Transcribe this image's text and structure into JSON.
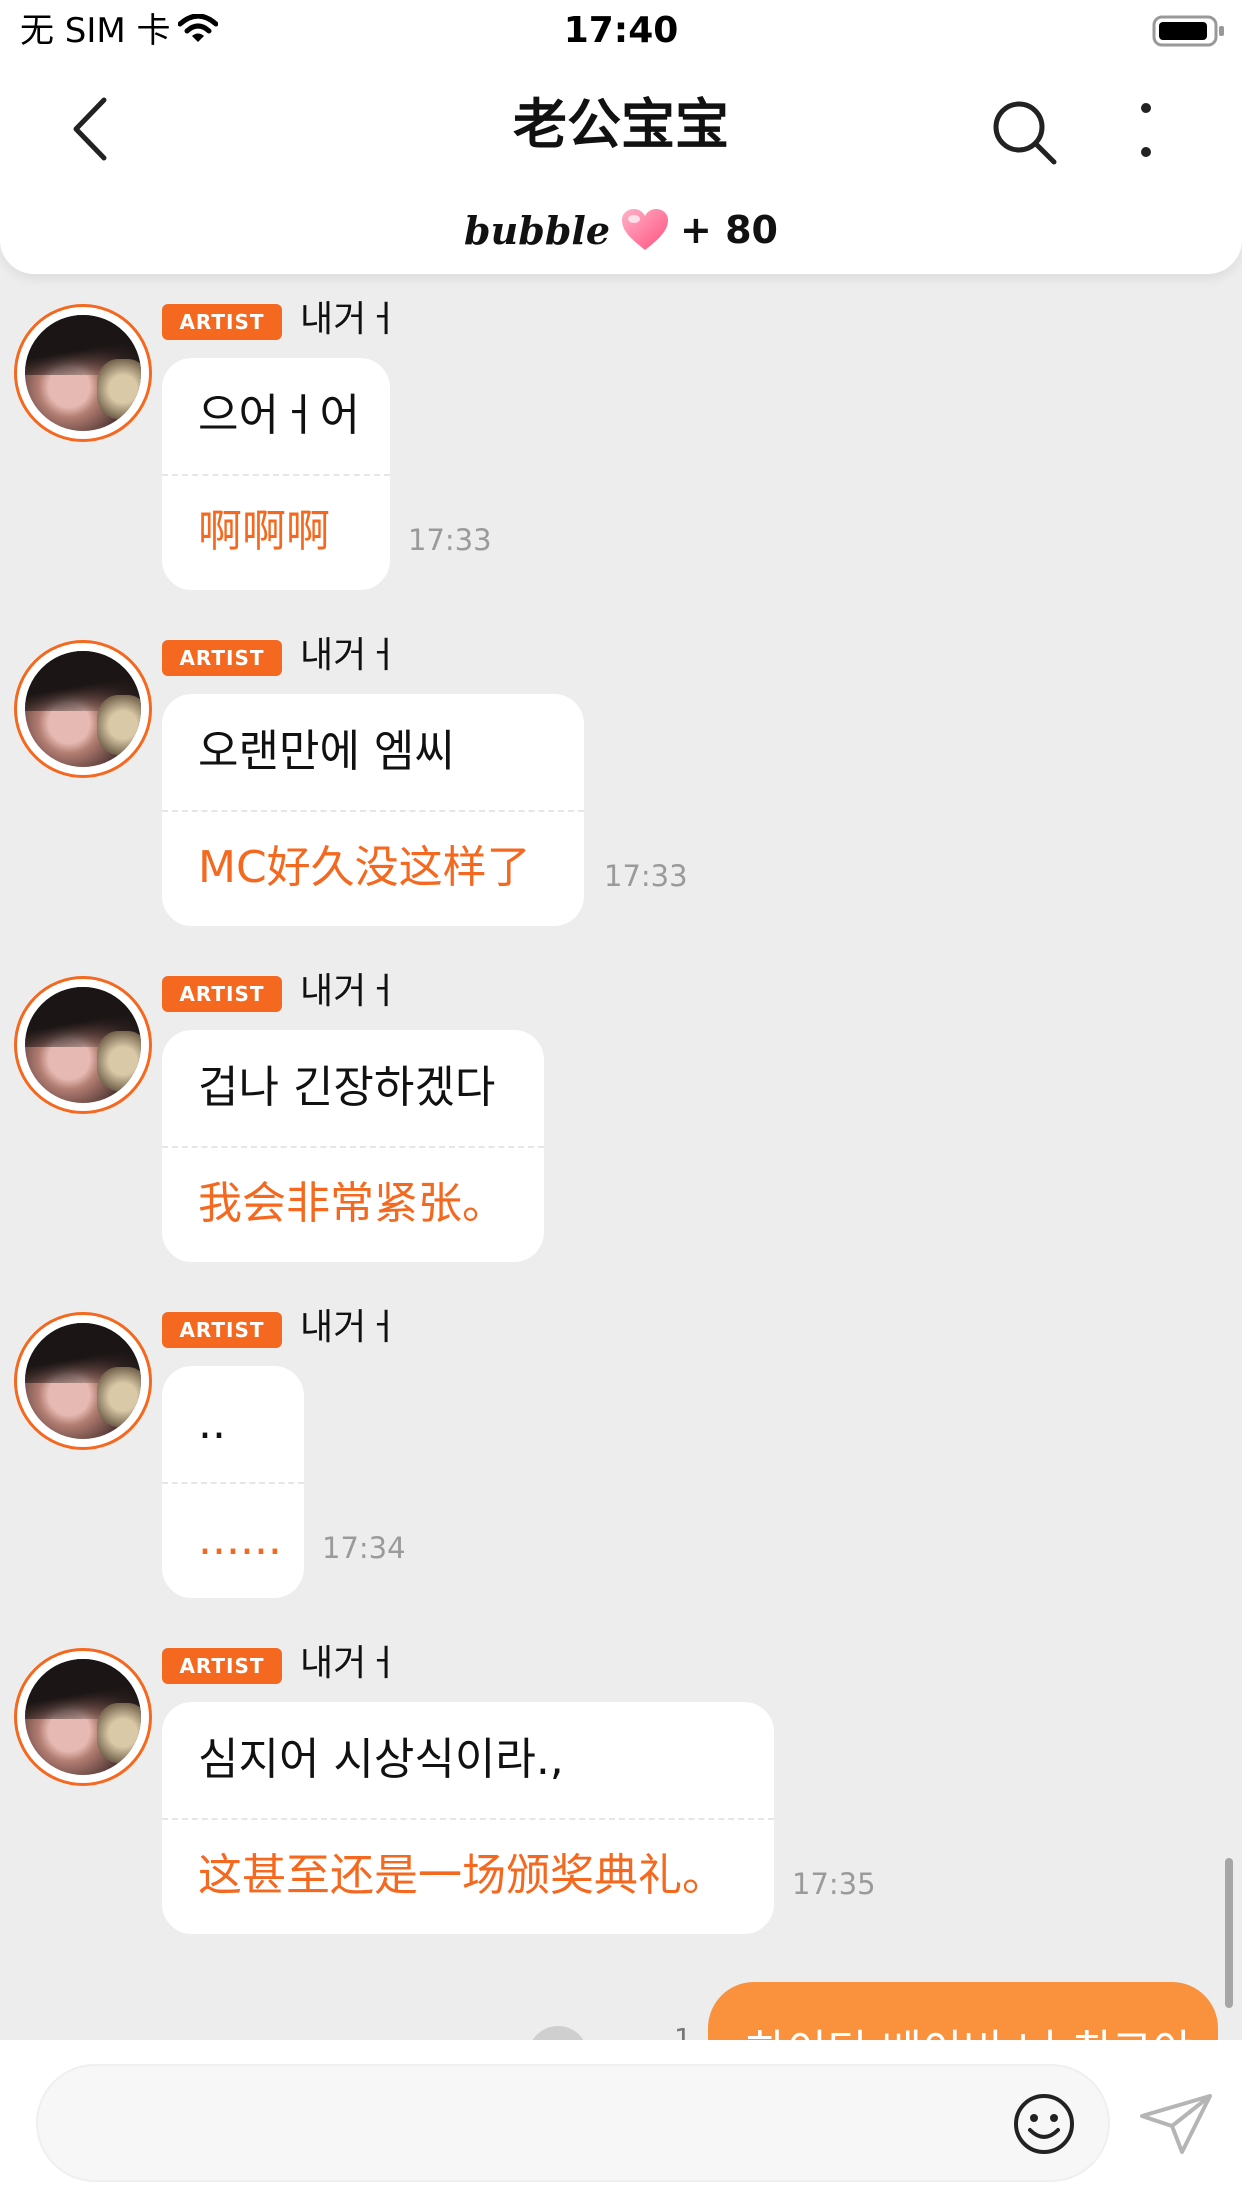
{
  "status_bar": {
    "carrier": "无 SIM 卡",
    "time": "17:40"
  },
  "header": {
    "title": "老公宝宝",
    "bubble_logo": "bubble",
    "bubble_count": "+ 80"
  },
  "messages": [
    {
      "badge": "ARTIST",
      "sender": "내거ㅓ",
      "original": "으어ㅓ어",
      "translation": "啊啊啊",
      "time": "17:33"
    },
    {
      "badge": "ARTIST",
      "sender": "내거ㅓ",
      "original": "오랜만에 엠씨",
      "translation": "MC好久没这样了",
      "time": "17:33"
    },
    {
      "badge": "ARTIST",
      "sender": "내거ㅓ",
      "original": "겁나 긴장하겠다",
      "translation": "我会非常紧张。",
      "time": ""
    },
    {
      "badge": "ARTIST",
      "sender": "내거ㅓ",
      "original": "..",
      "translation": "......",
      "time": "17:34"
    },
    {
      "badge": "ARTIST",
      "sender": "내거ㅓ",
      "original": "심지어 시상식이라.,",
      "translation": "这甚至还是一场颁奖典礼。",
      "time": "17:35"
    }
  ],
  "outgoing": {
    "read_count": "1",
    "text": "하이틴 베이비 너 최고야"
  },
  "input": {
    "placeholder": ""
  },
  "colors": {
    "accent": "#f4681f",
    "outgoing_bubble": "#f9913d",
    "background": "#ededed"
  },
  "icons": [
    "back-icon",
    "search-icon",
    "more-icon",
    "heart-icon",
    "emoji-icon",
    "send-icon",
    "wifi-icon",
    "battery-icon"
  ]
}
